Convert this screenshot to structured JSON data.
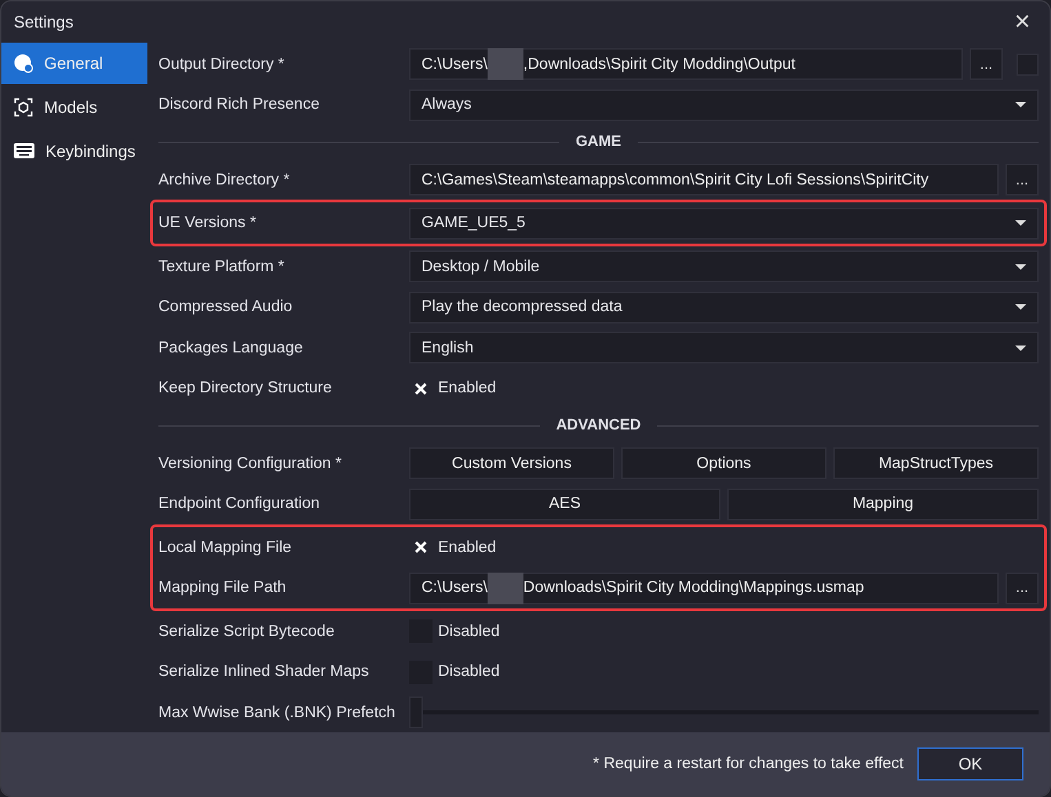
{
  "window": {
    "title": "Settings",
    "close": "×"
  },
  "sidebar": {
    "items": [
      {
        "label": "General",
        "selected": true
      },
      {
        "label": "Models",
        "selected": false
      },
      {
        "label": "Keybindings",
        "selected": false
      }
    ]
  },
  "rows": [
    {
      "kind": "path",
      "label": "Output Directory *",
      "before": "C:\\Users\\",
      "redacted": true,
      "after": ",Downloads\\Spirit City Modding\\Output",
      "browse": "...",
      "checked": false
    },
    {
      "kind": "select",
      "label": "Discord Rich Presence",
      "value": "Always"
    },
    {
      "kind": "section",
      "label": "GAME"
    },
    {
      "kind": "path",
      "label": "Archive Directory *",
      "before": "C:\\Games\\Steam\\steamapps\\common\\Spirit City Lofi Sessions\\SpiritCity",
      "browse": "..."
    },
    {
      "kind": "highlight",
      "rows": [
        {
          "kind": "select",
          "label": "UE Versions *",
          "value": "GAME_UE5_5"
        }
      ]
    },
    {
      "kind": "select",
      "label": "Texture Platform *",
      "value": "Desktop / Mobile"
    },
    {
      "kind": "select",
      "label": "Compressed Audio",
      "value": "Play the decompressed data"
    },
    {
      "kind": "select",
      "label": "Packages Language",
      "value": "English"
    },
    {
      "kind": "checkbox",
      "label": "Keep Directory Structure",
      "checked": true,
      "text": "Enabled"
    },
    {
      "kind": "section",
      "label": "ADVANCED"
    },
    {
      "kind": "buttons",
      "label": "Versioning Configuration *",
      "buttons": [
        "Custom Versions",
        "Options",
        "MapStructTypes"
      ]
    },
    {
      "kind": "buttons",
      "label": "Endpoint Configuration",
      "buttons": [
        "AES",
        "Mapping"
      ]
    },
    {
      "kind": "highlight",
      "rows": [
        {
          "kind": "checkbox",
          "label": "Local Mapping File",
          "checked": true,
          "text": "Enabled"
        },
        {
          "kind": "path",
          "label": "Mapping File Path",
          "before": "C:\\Users\\",
          "redacted": true,
          "after": "Downloads\\Spirit City Modding\\Mappings.usmap",
          "browse": "..."
        }
      ]
    },
    {
      "kind": "checkbox",
      "label": "Serialize Script Bytecode",
      "checked": false,
      "text": "Disabled"
    },
    {
      "kind": "checkbox",
      "label": "Serialize Inlined Shader Maps",
      "checked": false,
      "text": "Disabled"
    },
    {
      "kind": "slider",
      "label": "Max Wwise Bank (.BNK) Prefetch",
      "level": 0
    }
  ],
  "footer": {
    "note": "* Require a restart for changes to take effect",
    "ok": "OK"
  }
}
